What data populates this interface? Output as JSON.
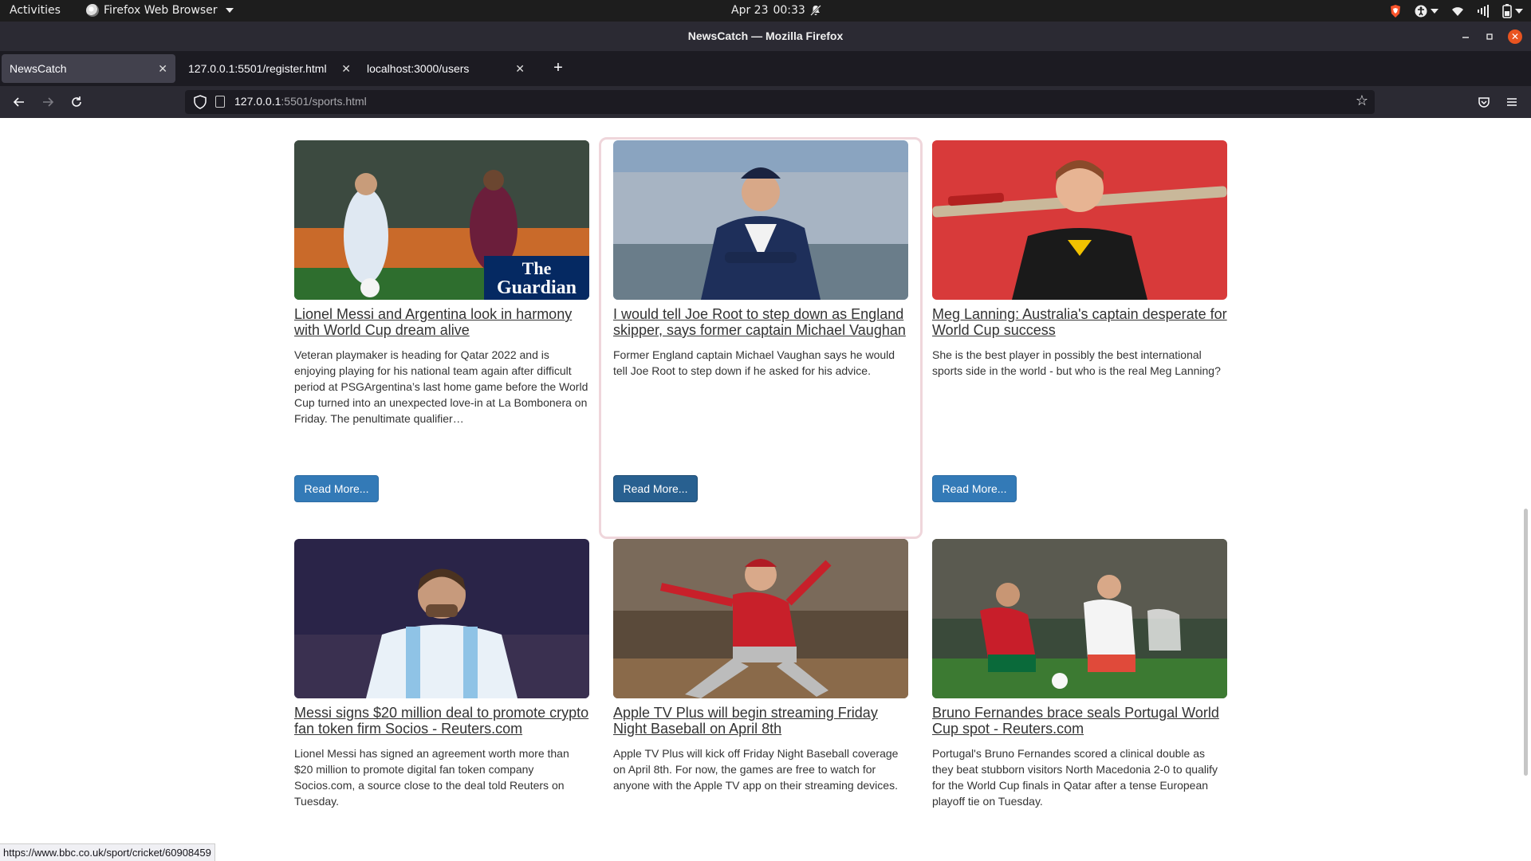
{
  "system_bar": {
    "activities": "Activities",
    "app_name": "Firefox Web Browser",
    "date": "Apr 23",
    "time": "00:33"
  },
  "window": {
    "title": "NewsCatch — Mozilla Firefox"
  },
  "tabs": [
    {
      "label": "NewsCatch",
      "active": true
    },
    {
      "label": "127.0.0.1:5501/register.html",
      "active": false
    },
    {
      "label": "localhost:3000/users",
      "active": false
    }
  ],
  "urlbar": {
    "host": "127.0.0.1",
    "path": ":5501/sports.html"
  },
  "articles": [
    {
      "title": "Lionel Messi and Argentina look in harmony with World Cup dream alive",
      "description": "Veteran playmaker is heading for Qatar 2022 and is enjoying playing for his national team again after difficult period at PSGArgentina’s last home game before the World Cup turned into an unexpected love-in at La Bombonera on Friday. The penultimate qualifier…",
      "button": "Read More...",
      "image_overlay": "The Guardian",
      "image_overlay_lines": [
        "The",
        "Guardian"
      ]
    },
    {
      "title": "I would tell Joe Root to step down as England skipper, says former captain Michael Vaughan",
      "description": "Former England captain Michael Vaughan says he would tell Joe Root to step down if he asked for his advice.",
      "button": "Read More..."
    },
    {
      "title": "Meg Lanning: Australia's captain desperate for World Cup success",
      "description": "She is the best player in possibly the best international sports side in the world - but who is the real Meg Lanning?",
      "button": "Read More..."
    },
    {
      "title": "Messi signs $20 million deal to promote crypto fan token firm Socios - Reuters.com",
      "description": "Lionel Messi has signed an agreement worth more than $20 million to promote digital fan token company Socios.com, a source close to the deal told Reuters on Tuesday."
    },
    {
      "title": "Apple TV Plus will begin streaming Friday Night Baseball on April 8th",
      "description": "Apple TV Plus will kick off Friday Night Baseball coverage on April 8th. For now, the games are free to watch for anyone with the Apple TV app on their streaming devices."
    },
    {
      "title": "Bruno Fernandes brace seals Portugal World Cup spot - Reuters.com",
      "description": "Portugal's Bruno Fernandes scored a clinical double as they beat stubborn visitors North Macedonia 2-0 to qualify for the World Cup finals in Qatar after a tense European playoff tie on Tuesday."
    }
  ],
  "status_url": "https://www.bbc.co.uk/sport/cricket/60908459",
  "colors": {
    "button_primary": "#337ab7",
    "button_hover": "#286090",
    "browser_chrome": "#2b2a33",
    "tabstrip": "#1c1b22"
  }
}
